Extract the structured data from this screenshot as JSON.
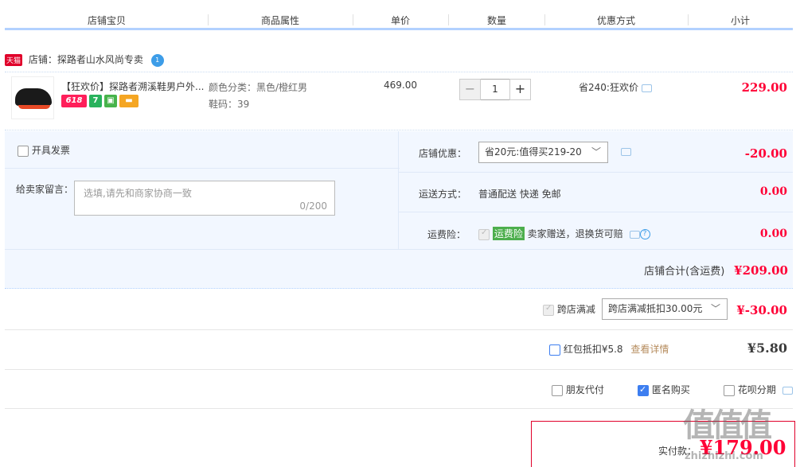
{
  "header": {
    "cols": [
      "店铺宝贝",
      "商品属性",
      "单价",
      "数量",
      "优惠方式",
      "小计"
    ]
  },
  "shop": {
    "tmall_badge": "天猫",
    "label": "店铺：",
    "name": "探路者山水风尚专卖",
    "chat_icon_text": "1"
  },
  "item": {
    "title": "【狂欢价】探路者溯溪鞋男户外...",
    "badges": [
      "618",
      "7"
    ],
    "attr_color": "颜色分类：黑色/橙红男",
    "attr_size": "鞋码：39",
    "unit_price": "469.00",
    "quantity": "1",
    "qty_minus": "−",
    "qty_plus": "+",
    "promo": "省240:狂欢价",
    "subtotal": "229.00"
  },
  "order": {
    "invoice_label": "开具发票",
    "memo_label": "给卖家留言：",
    "memo_placeholder": "选填,请先和商家协商一致",
    "memo_count": "0/200",
    "shop_discount_label": "店铺优惠：",
    "shop_discount_value": "省20元:值得买219-20",
    "shop_discount_amount": "-20.00",
    "shipping_label": "运送方式：",
    "shipping_value": "普通配送 快递 免邮",
    "shipping_amount": "0.00",
    "insurance_label": "运费险：",
    "insurance_tag": "运费险",
    "insurance_desc": "卖家赠送，退换货可赔",
    "insurance_amount": "0.00",
    "shop_total_label": "店铺合计(含运费)",
    "shop_total": "¥209.00"
  },
  "cross_store": {
    "label": "跨店满减",
    "select_value": "跨店满减抵扣30.00元",
    "amount": "¥-30.00"
  },
  "redpacket": {
    "label": "红包抵扣¥5.8",
    "link": "查看详情",
    "amount": "¥5.80"
  },
  "options": {
    "friend_pay": "朋友代付",
    "anonymous": "匿名购买",
    "huabei": "花呗分期"
  },
  "payment": {
    "label": "实付款：",
    "amount": "¥179.00"
  },
  "watermark": {
    "big": "值值值",
    "small": "zhizhizhi.com"
  },
  "colors": {
    "accent_red": "#ff0036",
    "header_border": "#b2d1ff",
    "panel_bg": "#f2f7ff"
  }
}
